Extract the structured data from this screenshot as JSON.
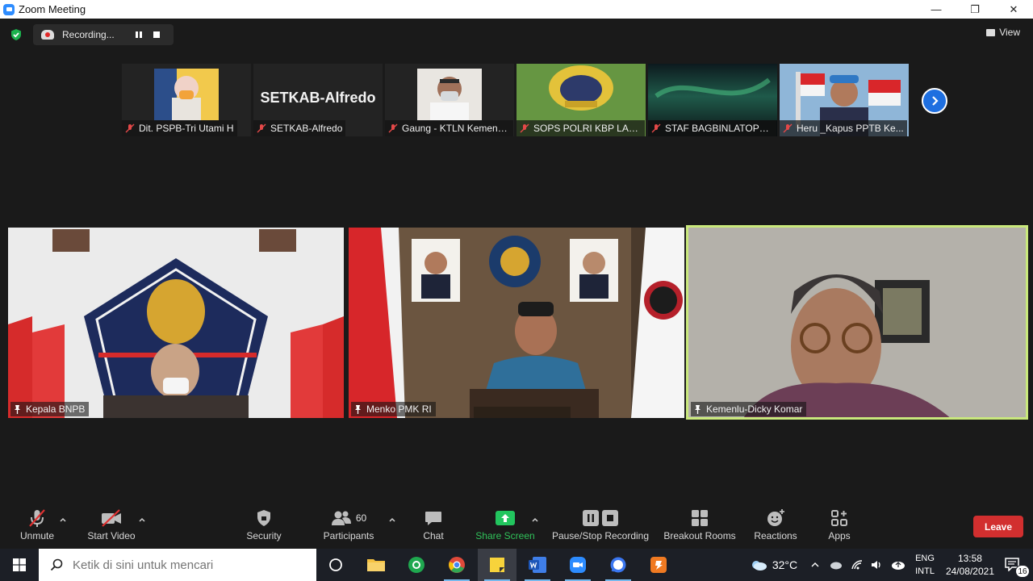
{
  "window": {
    "title": "Zoom Meeting",
    "controls": [
      "—",
      "❐",
      "✕"
    ]
  },
  "recording": {
    "label": "Recording..."
  },
  "view": {
    "label": "View"
  },
  "thumbnails": [
    {
      "name": "Dit. PSPB-Tri Utami H"
    },
    {
      "name": "SETKAB-Alfredo",
      "display_text": "SETKAB-Alfredo"
    },
    {
      "name": "Gaung - KTLN Kemens..."
    },
    {
      "name": "SOPS POLRI KBP LAKS..."
    },
    {
      "name": "STAF BAGBINLATOPS ..."
    },
    {
      "name": "Heru _Kapus PPTB Ke..."
    }
  ],
  "tiles": [
    {
      "name": "Kepala BNPB"
    },
    {
      "name": "Menko PMK RI"
    },
    {
      "name": "Kemenlu-Dicky Komar"
    }
  ],
  "toolbar": {
    "unmute": "Unmute",
    "start_video": "Start Video",
    "security": "Security",
    "participants": "Participants",
    "participants_count": "60",
    "chat": "Chat",
    "share_screen": "Share Screen",
    "pause_stop_recording": "Pause/Stop Recording",
    "breakout_rooms": "Breakout Rooms",
    "reactions": "Reactions",
    "apps": "Apps",
    "leave": "Leave"
  },
  "taskbar": {
    "search_placeholder": "Ketik di sini untuk mencari",
    "temperature": "32°C",
    "lang_top": "ENG",
    "lang_bottom": "INTL",
    "time": "13:58",
    "date": "24/08/2021",
    "notification_count": "16"
  },
  "colors": {
    "accent_blue": "#1e6fe0",
    "share_green": "#30c25a",
    "leave_red": "#d22f2f",
    "active_speaker": "#c9e87c"
  }
}
